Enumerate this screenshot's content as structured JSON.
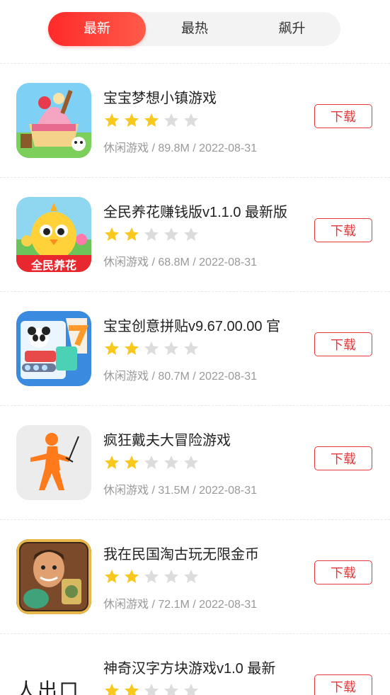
{
  "tabs": [
    {
      "label": "最新",
      "active": true
    },
    {
      "label": "最热",
      "active": false
    },
    {
      "label": "飙升",
      "active": false
    }
  ],
  "colors": {
    "accent": "#ff2a2a",
    "star_on": "#f8c91c",
    "star_off": "#dcdcdc",
    "button": "#e8373a"
  },
  "download_label": "下载",
  "apps": [
    {
      "name": "宝宝梦想小镇游戏",
      "rating": 3,
      "meta": "休闲游戏 / 89.8M / 2022-08-31",
      "icon": "ice-cream-shop-icon"
    },
    {
      "name": "全民养花赚钱版v1.1.0 最新版",
      "rating": 2,
      "meta": "休闲游戏 / 68.8M / 2022-08-31",
      "icon": "chick-flower-icon",
      "icon_text": "全民养花"
    },
    {
      "name": "宝宝创意拼贴v9.67.00.00 官",
      "rating": 2,
      "meta": "休闲游戏 / 80.7M / 2022-08-31",
      "icon": "panda-collage-icon"
    },
    {
      "name": "疯狂戴夫大冒险游戏",
      "rating": 2,
      "meta": "休闲游戏 / 31.5M / 2022-08-31",
      "icon": "stick-figure-sword-icon"
    },
    {
      "name": "我在民国淘古玩无限金币",
      "rating": 2,
      "meta": "休闲游戏 / 72.1M / 2022-08-31",
      "icon": "antique-dealer-icon"
    },
    {
      "name": "神奇汉字方块游戏v1.0 最新",
      "rating": 2,
      "meta": "",
      "icon": "chinese-character-blocks-icon",
      "icon_text": "人出口"
    }
  ]
}
